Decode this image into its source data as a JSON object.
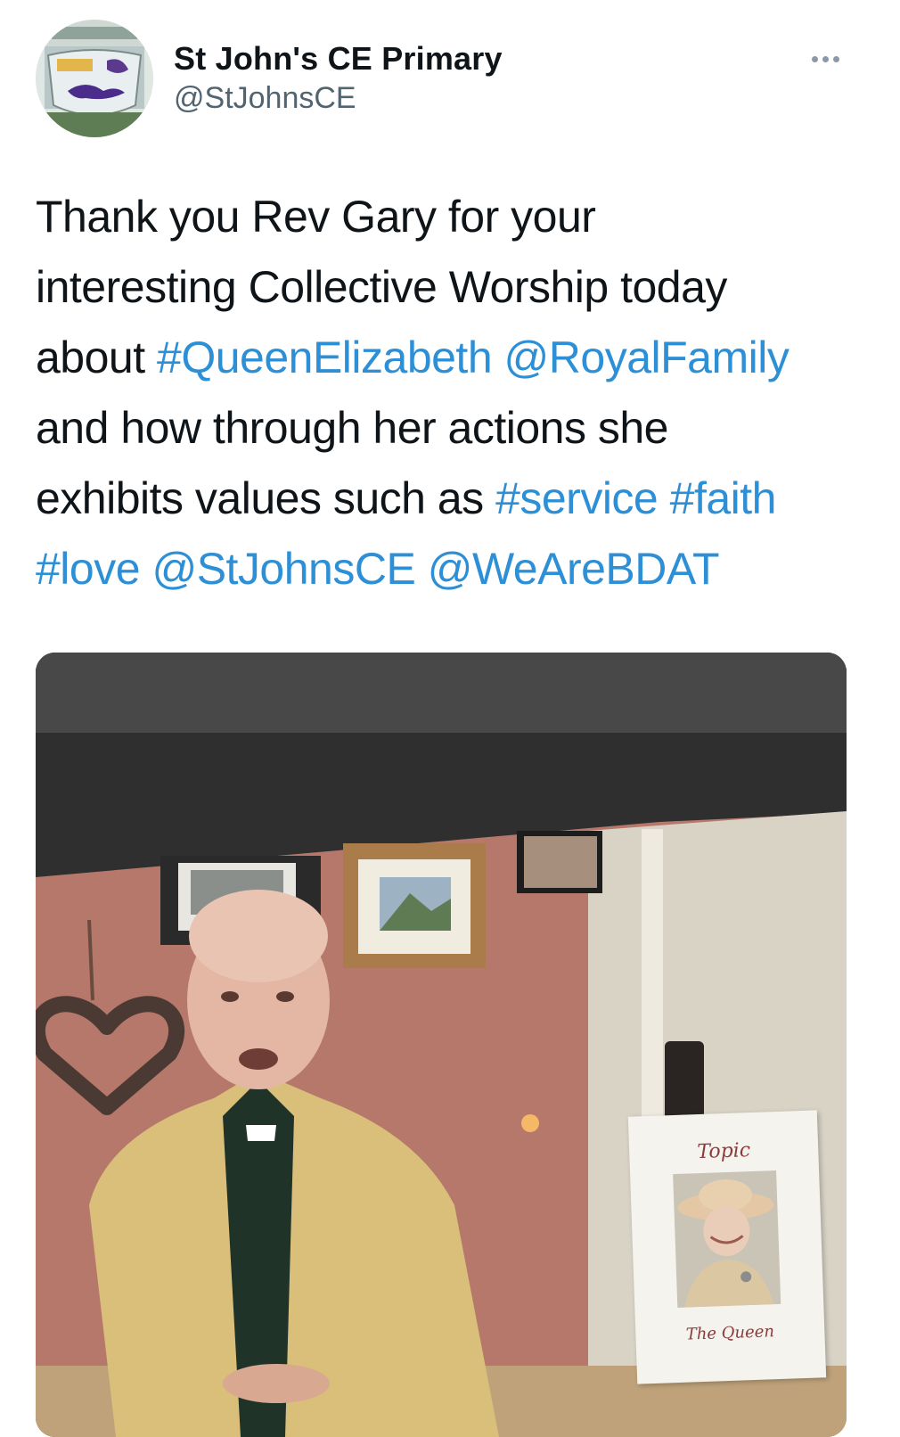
{
  "tweet": {
    "author": {
      "display_name": "St John's CE Primary",
      "handle": "@StJohnsCE"
    },
    "more_icon": "more-horizontal-icon",
    "text_lines": [
      [
        {
          "text": "Thank you Rev Gary for your",
          "link": false
        }
      ],
      [
        {
          "text": "interesting Collective Worship today",
          "link": false
        }
      ],
      [
        {
          "text": "about ",
          "link": false
        },
        {
          "text": "#QueenElizabeth",
          "link": true
        },
        {
          "text": " ",
          "link": false
        },
        {
          "text": "@RoyalFamily",
          "link": true
        }
      ],
      [
        {
          "text": "and how through her actions she",
          "link": false
        }
      ],
      [
        {
          "text": "exhibits values such as ",
          "link": false
        },
        {
          "text": "#service",
          "link": true
        },
        {
          "text": " ",
          "link": false
        },
        {
          "text": "#faith",
          "link": true
        }
      ],
      [
        {
          "text": "#love",
          "link": true
        },
        {
          "text": " ",
          "link": false
        },
        {
          "text": "@StJohnsCE",
          "link": true
        },
        {
          "text": " ",
          "link": false
        },
        {
          "text": "@WeAreBDAT",
          "link": true
        }
      ]
    ],
    "media": {
      "card_topic": "Topic",
      "card_footer": "The Queen"
    },
    "colors": {
      "link": "#2d8fd6",
      "text": "#0f1419",
      "secondary": "#536471"
    }
  }
}
